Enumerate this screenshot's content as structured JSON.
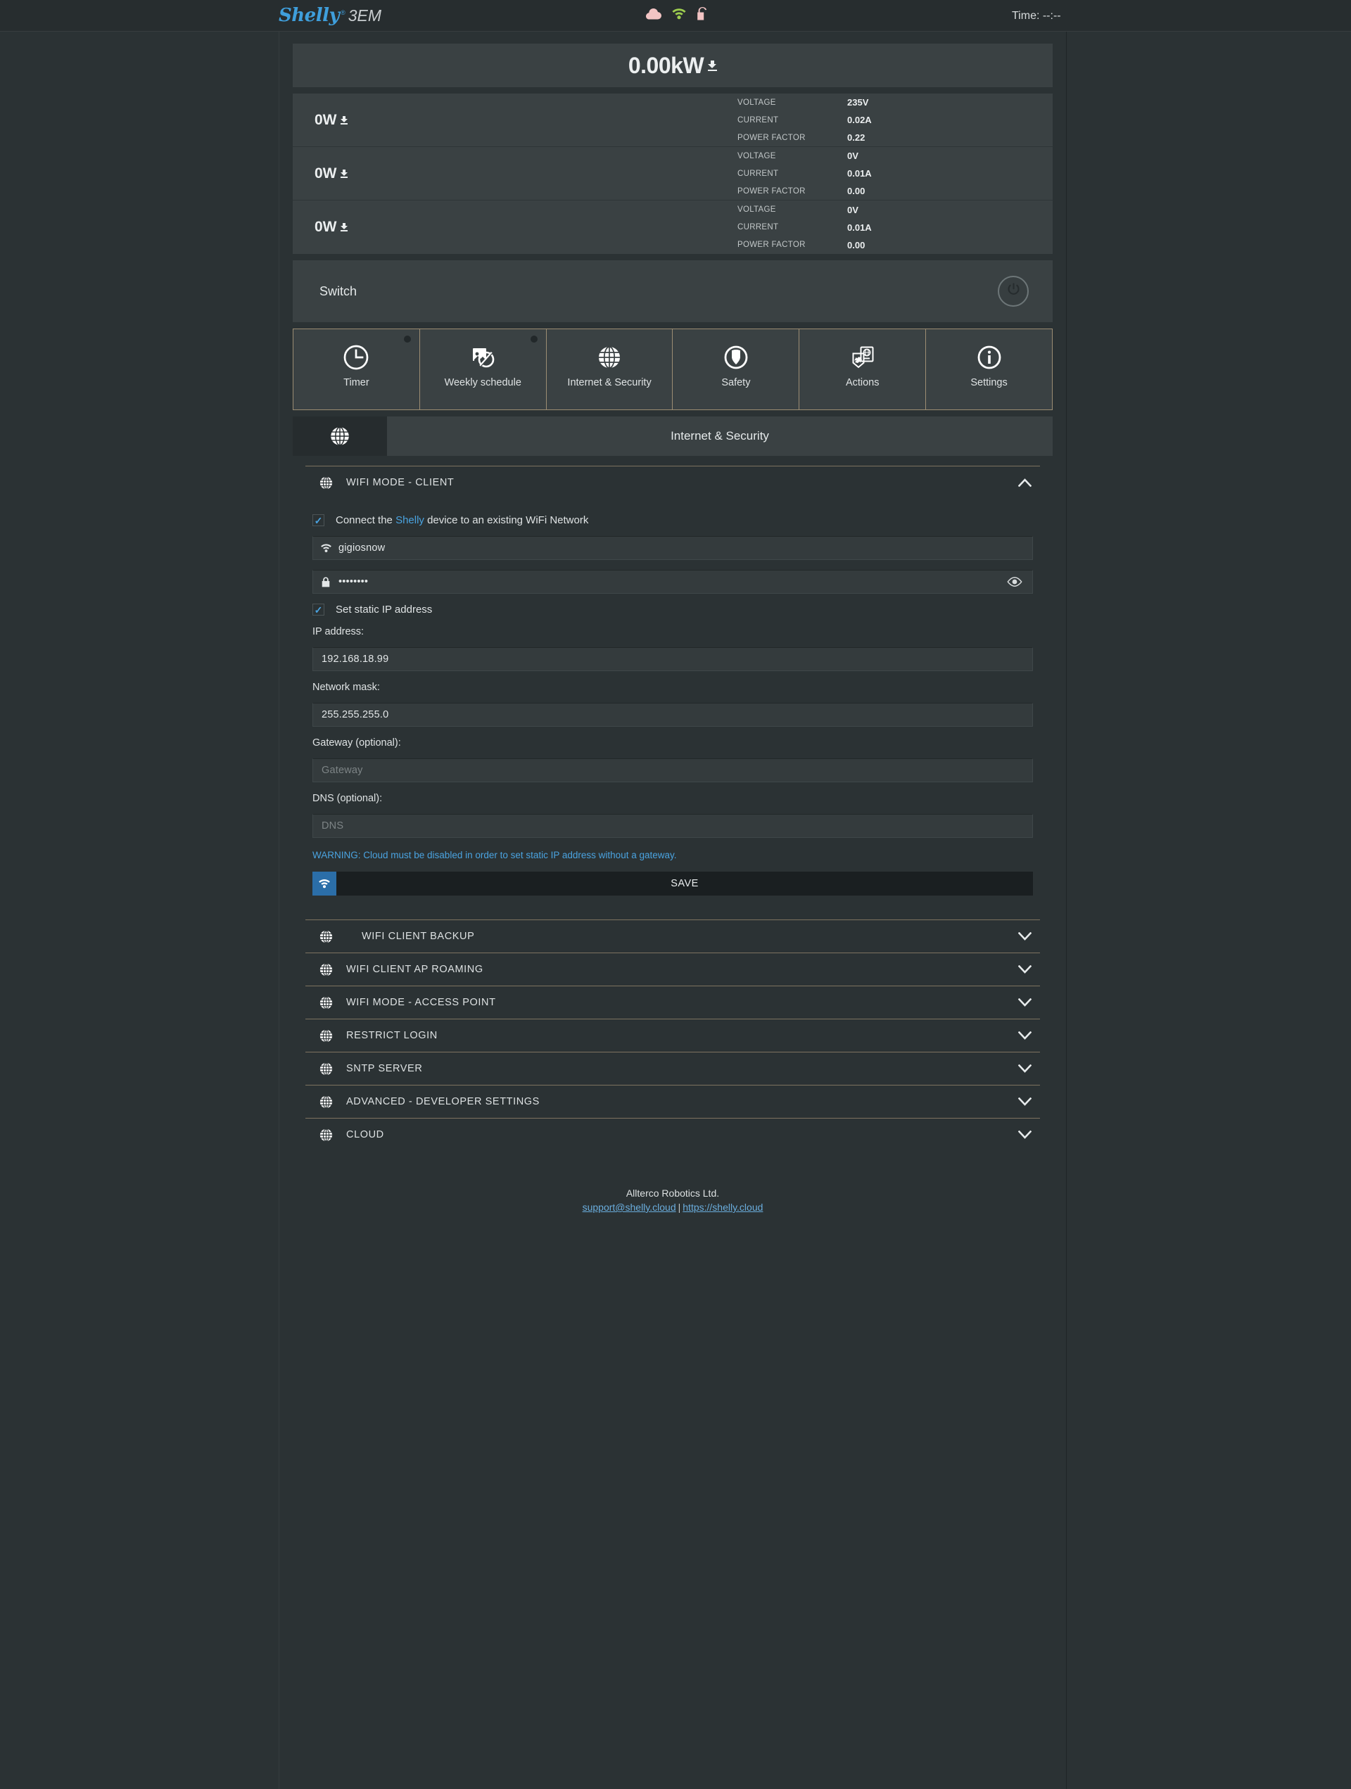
{
  "header": {
    "brand": "Shelly",
    "registered": "®",
    "model": "3EM",
    "time_label": "Time: --:--",
    "icons": [
      {
        "name": "cloud-icon",
        "color": "#f2c4c4"
      },
      {
        "name": "wifi-icon",
        "color": "#9dcd4f"
      },
      {
        "name": "unlock-icon",
        "color": "#f2c4c4"
      }
    ]
  },
  "total": {
    "value": "0.00kW",
    "direction_icon": "import-arrow-icon"
  },
  "phases": [
    {
      "power": "0W",
      "metrics": [
        {
          "name": "VOLTAGE",
          "value": "235V"
        },
        {
          "name": "CURRENT",
          "value": "0.02A"
        },
        {
          "name": "POWER FACTOR",
          "value": "0.22"
        }
      ]
    },
    {
      "power": "0W",
      "metrics": [
        {
          "name": "VOLTAGE",
          "value": "0V"
        },
        {
          "name": "CURRENT",
          "value": "0.01A"
        },
        {
          "name": "POWER FACTOR",
          "value": "0.00"
        }
      ]
    },
    {
      "power": "0W",
      "metrics": [
        {
          "name": "VOLTAGE",
          "value": "0V"
        },
        {
          "name": "CURRENT",
          "value": "0.01A"
        },
        {
          "name": "POWER FACTOR",
          "value": "0.00"
        }
      ]
    }
  ],
  "switch": {
    "label": "Switch",
    "power_button_icon": "power-icon"
  },
  "tabs": [
    {
      "label": "Timer",
      "icon": "clock-icon",
      "has_dot": true
    },
    {
      "label": "Weekly schedule",
      "icon": "weekly-schedule-icon",
      "has_dot": true
    },
    {
      "label": "Internet & Security",
      "icon": "globe-icon",
      "has_dot": false
    },
    {
      "label": "Safety",
      "icon": "shield-icon",
      "has_dot": false
    },
    {
      "label": "Actions",
      "icon": "actions-icon",
      "has_dot": false
    },
    {
      "label": "Settings",
      "icon": "info-icon",
      "has_dot": false
    }
  ],
  "section": {
    "icon": "globe-icon",
    "title": "Internet & Security"
  },
  "wifi_client": {
    "title": "WIFI MODE - CLIENT",
    "expanded": true,
    "chevron": "chevron-up-icon",
    "connect_checkbox": {
      "checked": true,
      "label_before": "Connect the ",
      "label_accent": "Shelly",
      "label_after": " device to an existing WiFi Network"
    },
    "ssid": {
      "value": "gigiosnow",
      "icon": "wifi-icon"
    },
    "password": {
      "value": "••••••••",
      "icon": "lock-icon",
      "reveal_icon": "eye-icon"
    },
    "static_ip_checkbox": {
      "checked": true,
      "label": "Set static IP address"
    },
    "ip_address": {
      "label": "IP address:",
      "value": "192.168.18.99"
    },
    "network_mask": {
      "label": "Network mask:",
      "value": "255.255.255.0"
    },
    "gateway": {
      "label": "Gateway (optional):",
      "value": "",
      "placeholder": "Gateway"
    },
    "dns": {
      "label": "DNS (optional):",
      "value": "",
      "placeholder": "DNS"
    },
    "warning": "WARNING: Cloud must be disabled in order to set static IP address without a gateway.",
    "save_label": "SAVE",
    "save_icon": "wifi-icon"
  },
  "collapsed_sections": [
    {
      "title": "WIFI CLIENT BACKUP",
      "icon": "globe-icon",
      "chevron": "chevron-down-icon",
      "indented": true
    },
    {
      "title": "WIFI CLIENT AP ROAMING",
      "icon": "globe-icon",
      "chevron": "chevron-down-icon",
      "indented": false
    },
    {
      "title": "WIFI MODE - ACCESS POINT",
      "icon": "globe-icon",
      "chevron": "chevron-down-icon",
      "indented": false
    },
    {
      "title": "RESTRICT LOGIN",
      "icon": "globe-icon",
      "chevron": "chevron-down-icon",
      "indented": false
    },
    {
      "title": "SNTP SERVER",
      "icon": "globe-icon",
      "chevron": "chevron-down-icon",
      "indented": false
    },
    {
      "title": "ADVANCED - DEVELOPER SETTINGS",
      "icon": "globe-icon",
      "chevron": "chevron-down-icon",
      "indented": false
    },
    {
      "title": "CLOUD",
      "icon": "globe-icon",
      "chevron": "chevron-down-icon",
      "indented": false
    }
  ],
  "footer": {
    "company": "Allterco Robotics Ltd.",
    "email": "support@shelly.cloud",
    "separator": "|",
    "website": "https://shelly.cloud"
  },
  "colors": {
    "page_bg": "#2b3234",
    "panel_bg": "#3a4143",
    "accent_blue": "#4aa3e0",
    "divider_gold": "#9c8d73",
    "save_blue": "#2b6ea8"
  }
}
